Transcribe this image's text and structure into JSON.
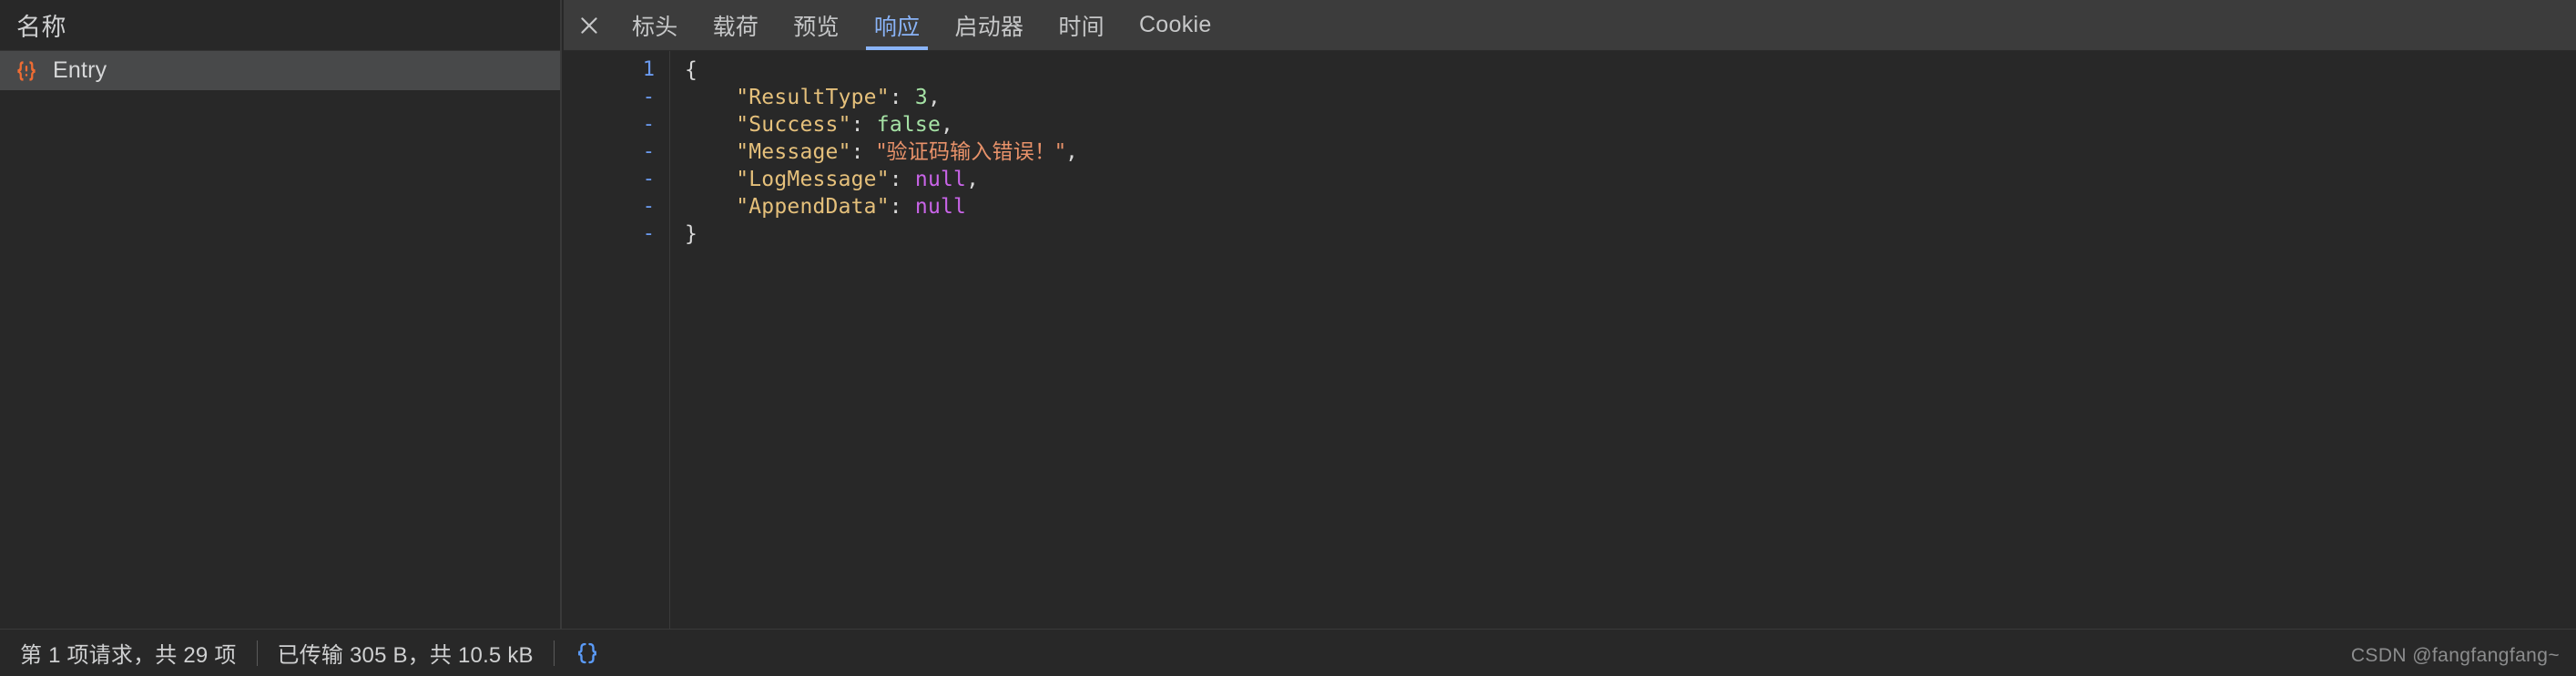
{
  "theme": {
    "bg_panel": "#282828",
    "bg_tabbar": "#3c3c3c",
    "bg_selected_row": "#48494a",
    "accent_blue": "#8ab4f8",
    "icon_orange": "#ef6c33",
    "text_primary": "#cfd0d1"
  },
  "left_panel": {
    "column_header": "名称",
    "requests": [
      {
        "name": "Entry",
        "icon": "json-braces-icon",
        "selected": true
      }
    ]
  },
  "detail_panel": {
    "close_icon": "close-icon",
    "tabs": [
      {
        "label": "标头",
        "name": "headers",
        "active": false
      },
      {
        "label": "载荷",
        "name": "payload",
        "active": false
      },
      {
        "label": "预览",
        "name": "preview",
        "active": false
      },
      {
        "label": "响应",
        "name": "response",
        "active": true
      },
      {
        "label": "启动器",
        "name": "initiator",
        "active": false
      },
      {
        "label": "时间",
        "name": "timing",
        "active": false
      },
      {
        "label": "Cookie",
        "name": "cookies",
        "active": false
      }
    ]
  },
  "response_body": {
    "gutter": [
      "1",
      "-",
      "-",
      "-",
      "-",
      "-",
      "-"
    ],
    "lines": [
      [
        {
          "t": "punct",
          "v": "{"
        }
      ],
      [
        {
          "t": "plain",
          "v": "    "
        },
        {
          "t": "key",
          "v": "\"ResultType\""
        },
        {
          "t": "colon",
          "v": ":"
        },
        {
          "t": "plain",
          "v": " "
        },
        {
          "t": "num",
          "v": "3"
        },
        {
          "t": "comma",
          "v": ","
        }
      ],
      [
        {
          "t": "plain",
          "v": "    "
        },
        {
          "t": "key",
          "v": "\"Success\""
        },
        {
          "t": "colon",
          "v": ":"
        },
        {
          "t": "plain",
          "v": " "
        },
        {
          "t": "bool",
          "v": "false"
        },
        {
          "t": "comma",
          "v": ","
        }
      ],
      [
        {
          "t": "plain",
          "v": "    "
        },
        {
          "t": "key",
          "v": "\"Message\""
        },
        {
          "t": "colon",
          "v": ":"
        },
        {
          "t": "plain",
          "v": " "
        },
        {
          "t": "str",
          "v": "\"验证码输入错误！\""
        },
        {
          "t": "comma",
          "v": ","
        }
      ],
      [
        {
          "t": "plain",
          "v": "    "
        },
        {
          "t": "key",
          "v": "\"LogMessage\""
        },
        {
          "t": "colon",
          "v": ":"
        },
        {
          "t": "plain",
          "v": " "
        },
        {
          "t": "null",
          "v": "null"
        },
        {
          "t": "comma",
          "v": ","
        }
      ],
      [
        {
          "t": "plain",
          "v": "    "
        },
        {
          "t": "key",
          "v": "\"AppendData\""
        },
        {
          "t": "colon",
          "v": ":"
        },
        {
          "t": "plain",
          "v": " "
        },
        {
          "t": "null",
          "v": "null"
        }
      ],
      [
        {
          "t": "punct",
          "v": "}"
        }
      ]
    ],
    "parsed": {
      "ResultType": 3,
      "Success": false,
      "Message": "验证码输入错误！",
      "LogMessage": null,
      "AppendData": null
    }
  },
  "status_bar": {
    "requests_summary": "第 1 项请求，共 29 项",
    "transfer_summary": "已传输 305 B，共 10.5 kB",
    "pretty_print_icon": "pretty-print-braces-icon",
    "watermark": "CSDN @fangfangfang~"
  }
}
